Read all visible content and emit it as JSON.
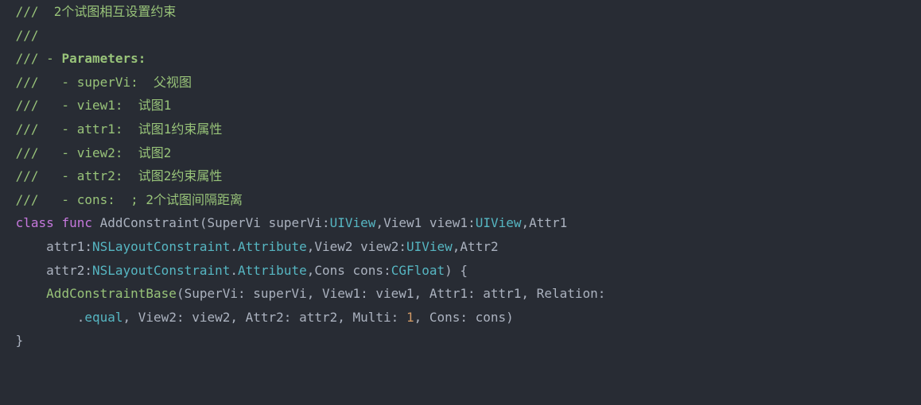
{
  "code": {
    "line1": {
      "slashes": " ///  ",
      "text": "2个试图相互设置约束"
    },
    "line2": {
      "slashes": " ///"
    },
    "line3": {
      "slashes": " /// - ",
      "bold": "Parameters:"
    },
    "line4": {
      "slashes": " ///   - ",
      "param": "superVi:  ",
      "desc": "父视图"
    },
    "line5": {
      "slashes": " ///   - ",
      "param": "view1:  ",
      "desc": "试图1"
    },
    "line6": {
      "slashes": " ///   - ",
      "param": "attr1:  ",
      "desc": "试图1约束属性"
    },
    "line7": {
      "slashes": " ///   - ",
      "param": "view2:  ",
      "desc": "试图2"
    },
    "line8": {
      "slashes": " ///   - ",
      "param": "attr2:  ",
      "desc": "试图2约束属性"
    },
    "line9": {
      "slashes": " ///   - ",
      "param": "cons:  ",
      "desc": "; 2个试图间隔距离"
    },
    "line10": {
      "kw_class": " class",
      "kw_func": "func",
      "fname": "AddConstraint",
      "lparen": "(",
      "p1_label": "SuperVi",
      "p1_name": "superVi",
      "p1_type": "UIView",
      "p2_label": "View1",
      "p2_name": "view1",
      "p2_type": "UIView",
      "p3_label": "Attr1"
    },
    "line11": {
      "indent": "     ",
      "p3_name": "attr1",
      "p3_type1": "NSLayoutConstraint",
      "p3_type2": "Attribute",
      "p4_label": "View2",
      "p4_name": "view2",
      "p4_type": "UIView",
      "p5_label": "Attr2"
    },
    "line12": {
      "indent": "     ",
      "p5_name": "attr2",
      "p5_type1": "NSLayoutConstraint",
      "p5_type2": "Attribute",
      "p6_label": "Cons",
      "p6_name": "cons",
      "p6_type": "CGFloat",
      "rparen_brace": ") {"
    },
    "line13": {
      "indent": "     ",
      "call": "AddConstraintBase",
      "args": "(SuperVi: superVi, View1: view1, Attr1: attr1, Relation:"
    },
    "line14": {
      "indent": "         ",
      "dot": ".",
      "member": "equal",
      "mid": ", View2: view2, Attr2: attr2, Multi: ",
      "num": "1",
      "end": ", Cons: cons)"
    },
    "line15": {
      "brace": " }"
    }
  }
}
